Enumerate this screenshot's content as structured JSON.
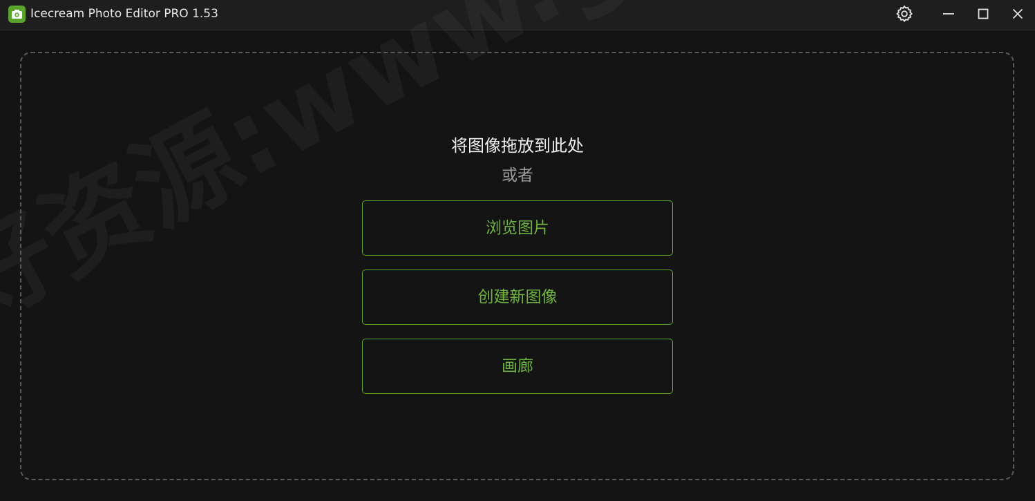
{
  "window": {
    "title": "Icecream Photo Editor PRO 1.53",
    "accent_color": "#6db33f",
    "background_color": "#141414"
  },
  "titlebar": {
    "icons": {
      "app": "camera-app-icon",
      "settings": "gear-icon",
      "minimize": "minimize-icon",
      "maximize": "maximize-icon",
      "close": "close-icon"
    }
  },
  "drop_zone": {
    "title": "将图像拖放到此处",
    "or_text": "或者",
    "buttons": {
      "browse": "浏览图片",
      "create": "创建新图像",
      "gallery": "画廊"
    }
  },
  "watermark": {
    "text": "好资源:www.goodziyuan.com"
  }
}
